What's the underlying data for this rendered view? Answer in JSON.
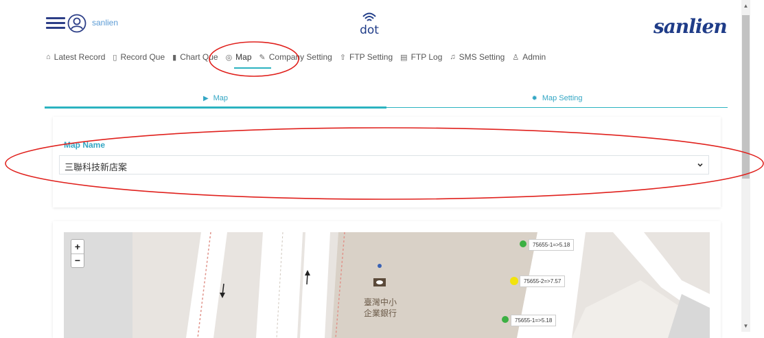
{
  "header": {
    "username": "sanlien",
    "center_logo_text": "dot",
    "brand_logo_text": "sanlien"
  },
  "nav": {
    "items": [
      {
        "label": "Latest Record",
        "icon": "home-icon"
      },
      {
        "label": "Record Que",
        "icon": "document-icon"
      },
      {
        "label": "Chart Que",
        "icon": "bar-chart-icon"
      },
      {
        "label": "Map",
        "icon": "map-pin-icon",
        "active": true
      },
      {
        "label": "Company Setting",
        "icon": "edit-icon"
      },
      {
        "label": "FTP Setting",
        "icon": "upload-icon"
      },
      {
        "label": "FTP Log",
        "icon": "file-icon"
      },
      {
        "label": "SMS Setting",
        "icon": "bell-icon"
      },
      {
        "label": "Admin",
        "icon": "user-icon"
      }
    ]
  },
  "subtabs": {
    "map": "Map",
    "setting": "Map Setting"
  },
  "map_name": {
    "label": "Map Name",
    "selected": "三聯科技新店案"
  },
  "map": {
    "bank_label_line1": "臺灣中小",
    "bank_label_line2": "企業銀行",
    "markers": [
      {
        "label": "75655-1=>5.18",
        "color": "#3cb043"
      },
      {
        "label": "75655-2=>7.57",
        "color": "#f2e30c"
      },
      {
        "label": "75655-1=>5.18",
        "color": "#3cb043"
      }
    ],
    "zoom_in": "+",
    "zoom_out": "−"
  },
  "colors": {
    "accent": "#2bb3c0",
    "brand": "#1f3c88",
    "annotation": "#e0201c"
  }
}
